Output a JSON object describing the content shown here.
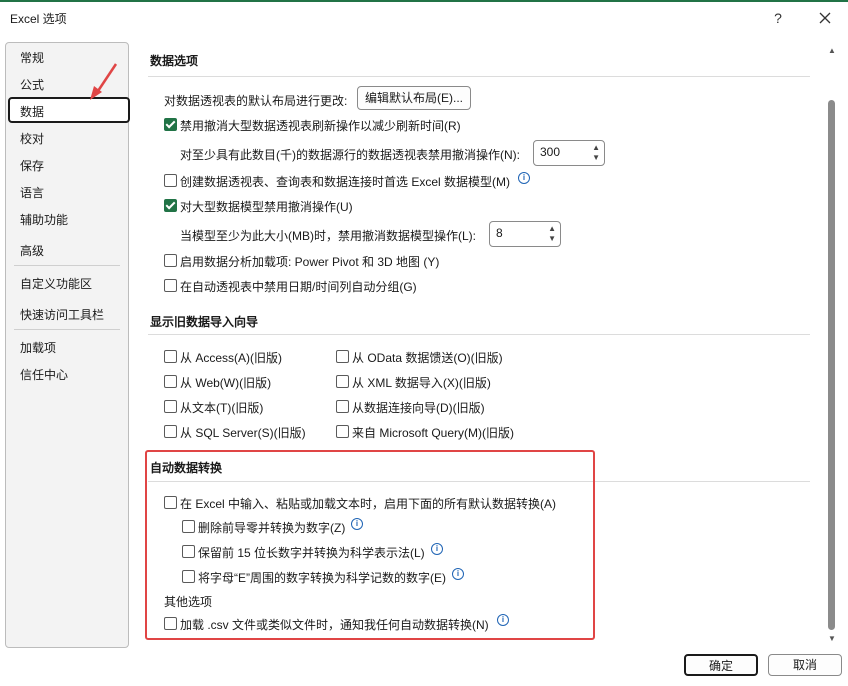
{
  "window": {
    "title": "Excel 选项",
    "help": "?"
  },
  "sidebar": {
    "items": [
      "常规",
      "公式",
      "数据",
      "校对",
      "保存",
      "语言",
      "辅助功能",
      "高级",
      "自定义功能区",
      "快速访问工具栏",
      "加载项",
      "信任中心"
    ],
    "selected_index": 2
  },
  "sections": {
    "data_options": {
      "title": "数据选项",
      "pivot_layout_label": "对数据透视表的默认布局进行更改:",
      "edit_layout_button": "编辑默认布局(E)...",
      "disable_undo_pivot": {
        "label": "禁用撤消大型数据透视表刷新操作以减少刷新时间(R)",
        "checked": true
      },
      "undo_rows_label": "对至少具有此数目(千)的数据源行的数据透视表禁用撤消操作(N):",
      "undo_rows_value": "300",
      "prefer_model": {
        "label": "创建数据透视表、查询表和数据连接时首选 Excel 数据模型(M)",
        "checked": false
      },
      "disable_undo_model": {
        "label": "对大型数据模型禁用撤消操作(U)",
        "checked": true
      },
      "model_size_label": "当模型至少为此大小(MB)时，禁用撤消数据模型操作(L):",
      "model_size_value": "8",
      "enable_addins": {
        "label": "启用数据分析加载项: Power Pivot 和 3D 地图 (Y)",
        "checked": false
      },
      "disable_autogroup": {
        "label": "在自动透视表中禁用日期/时间列自动分组(G)",
        "checked": false
      }
    },
    "legacy_wizards": {
      "title": "显示旧数据导入向导",
      "left": [
        "从 Access(A)(旧版)",
        "从 Web(W)(旧版)",
        "从文本(T)(旧版)",
        "从 SQL Server(S)(旧版)"
      ],
      "right": [
        "从 OData 数据馈送(O)(旧版)",
        "从 XML 数据导入(X)(旧版)",
        "从数据连接向导(D)(旧版)",
        "来自 Microsoft Query(M)(旧版)"
      ]
    },
    "auto_conversion": {
      "title": "自动数据转换",
      "enable_all": "在 Excel 中输入、粘贴或加载文本时，启用下面的所有默认数据转换(A)",
      "remove_zeros": "删除前导零并转换为数字(Z)",
      "keep_15": "保留前 15 位长数字并转换为科学表示法(L)",
      "convert_e": "将字母“E”周围的数字转换为科学记数的数字(E)",
      "other_title": "其他选项",
      "csv_notify": "加载 .csv 文件或类似文件时，通知我任何自动数据转换(N)"
    }
  },
  "footer": {
    "ok": "确定",
    "cancel": "取消"
  },
  "colors": {
    "accent": "#217346",
    "highlight": "#e04545",
    "info": "#1f64b5"
  }
}
